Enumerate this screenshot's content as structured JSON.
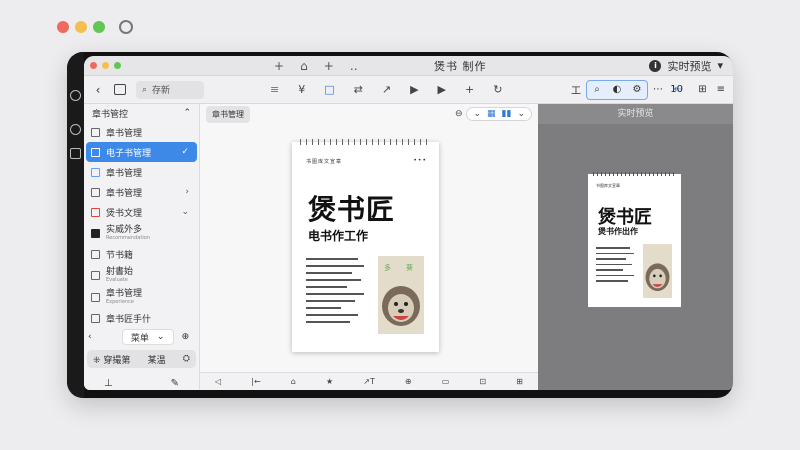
{
  "titlebar": {
    "title": "煲书 制作",
    "right_label": "实时预览",
    "mid_icons": [
      "+",
      "⌂",
      "+",
      "‥"
    ]
  },
  "toolbar": {
    "search_label": "存新",
    "tools": [
      "≡",
      "¥",
      "□",
      "⇄",
      "↗",
      "▶",
      "▶",
      "+",
      "↻"
    ],
    "zoom": "10"
  },
  "sidebar": {
    "header": "章书管控",
    "items": [
      {
        "label": "章书管理",
        "icon": "square"
      },
      {
        "label": "电子书管理",
        "icon": "blue",
        "active": true
      },
      {
        "label": "章书管理",
        "icon": "check"
      },
      {
        "label": "章书管理",
        "icon": "check",
        "chev": "›"
      },
      {
        "label": "煲书文理",
        "icon": "red",
        "chev": "⌄"
      },
      {
        "label": "实威外多",
        "sub": "Recommendation",
        "icon": "filled"
      },
      {
        "label": "节书籍",
        "icon": "square"
      },
      {
        "label": "射書始",
        "sub": "Evaluate",
        "icon": "square"
      },
      {
        "label": "章书管理",
        "sub": "Experience",
        "icon": "square"
      },
      {
        "label": "章书匠手什",
        "icon": "square"
      }
    ],
    "pill_label": "菜单",
    "bottom_left": "穿撮第",
    "bottom_mid": "某温",
    "bottom_right": "⛭"
  },
  "center": {
    "chip": "章书管理",
    "page": {
      "header": "书图库文宣章",
      "dots": "•••",
      "title": "煲书匠",
      "subtitle": "电书作工作"
    },
    "bottom_icons": [
      "◁",
      "|←",
      "⌂",
      "★",
      "↗T",
      "⊕",
      "▭",
      "⊡",
      "⊞"
    ]
  },
  "preview": {
    "label": "实时预览",
    "page": {
      "header": "书图库文宣章",
      "title": "煲书匠",
      "subtitle": "煲书作出作"
    }
  },
  "colors": {
    "accent": "#3d89e8",
    "preview_bg": "#7d7d80"
  }
}
